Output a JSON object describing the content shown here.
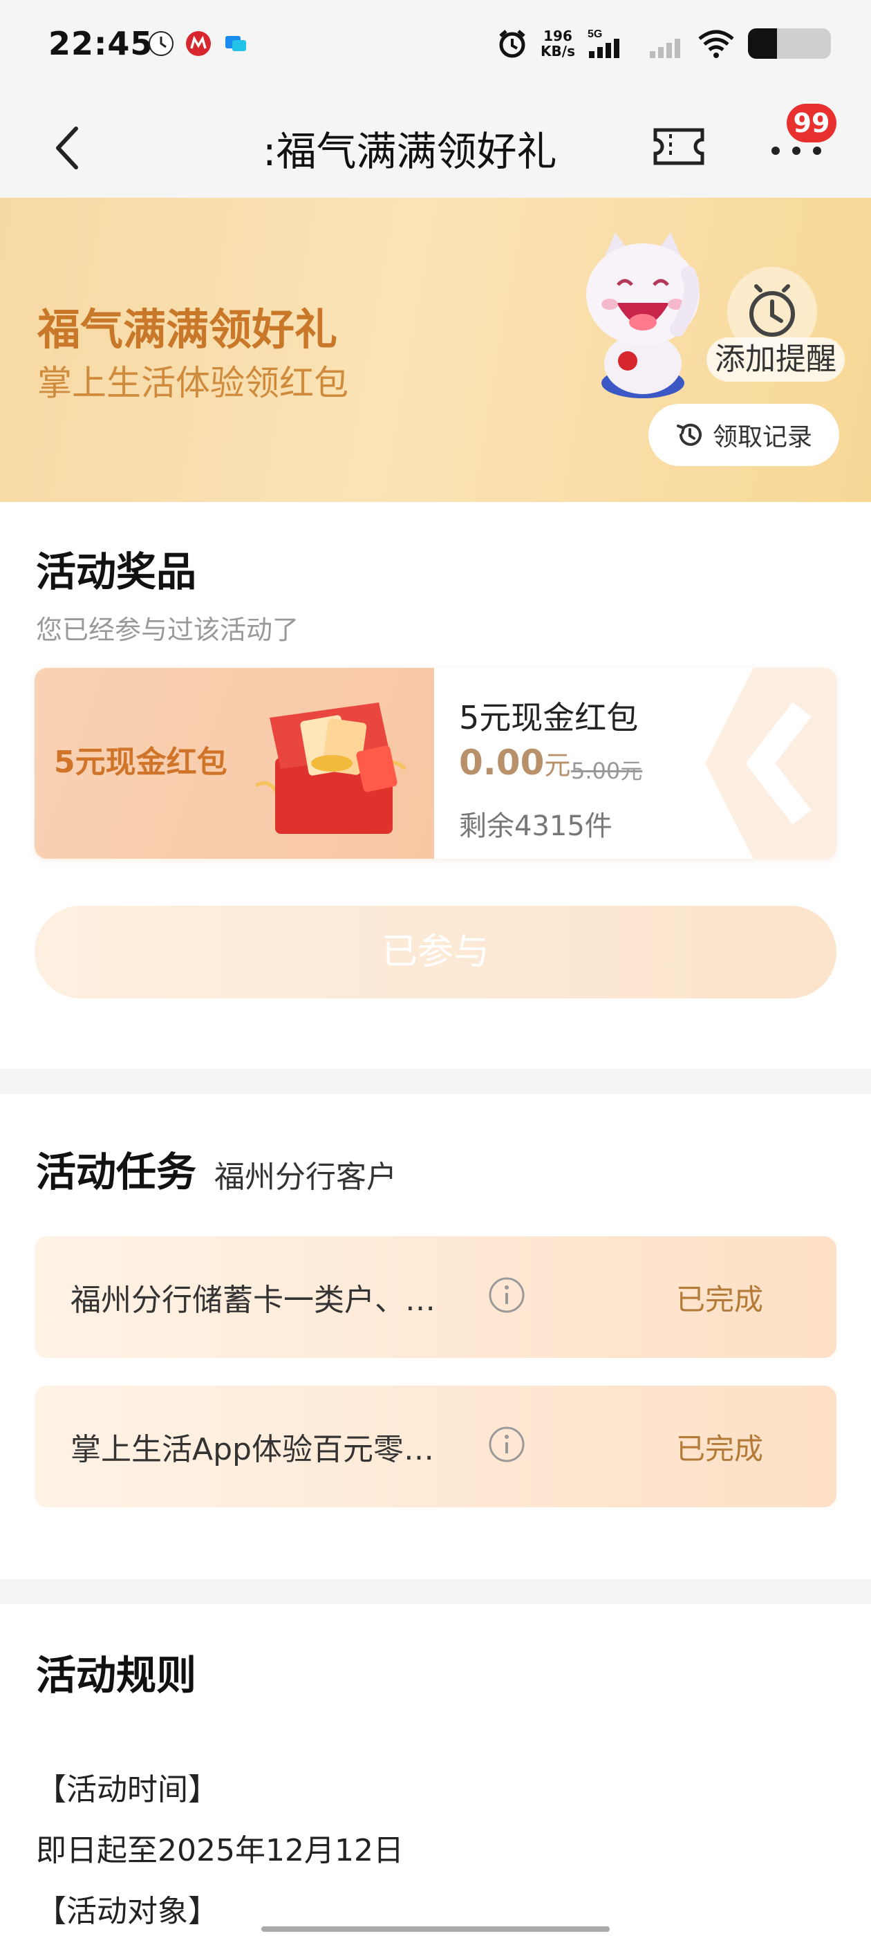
{
  "status_bar": {
    "time": "22:45",
    "speed_value": "196",
    "speed_unit": "KB/s",
    "network": "5G",
    "battery_level": 0.35,
    "app_icons": [
      "clock-app-icon",
      "cmb-bank-icon",
      "message-app-icon"
    ]
  },
  "nav": {
    "title": ":福气满满领好礼",
    "badge_count": "99",
    "icons": [
      "back-icon",
      "ticket-icon",
      "more-icon"
    ]
  },
  "banner": {
    "title": "福气满满领好礼",
    "subtitle": "掌上生活体验领红包",
    "remind_label": "添加提醒",
    "record_label": "领取记录"
  },
  "prizes": {
    "title": "活动奖品",
    "note": "您已经参与过该活动了",
    "card": {
      "left_label": "5元现金红包",
      "name": "5元现金红包",
      "price": "0.00",
      "price_unit": "元",
      "original_price": "5.00元",
      "remaining": "剩余4315件"
    },
    "button_label": "已参与"
  },
  "tasks": {
    "title": "活动任务",
    "subtitle": "福州分行客户",
    "items": [
      {
        "name": "福州分行储蓄卡一类户、…",
        "status": "已完成"
      },
      {
        "name": "掌上生活App体验百元零…",
        "status": "已完成"
      }
    ]
  },
  "rules": {
    "title": "活动规则",
    "lines": [
      "【活动时间】",
      "即日起至2025年12月12日",
      "【活动对象】"
    ]
  },
  "colors": {
    "accent": "#c9782a",
    "badge": "#e8312f",
    "status_done": "#b47a37"
  }
}
